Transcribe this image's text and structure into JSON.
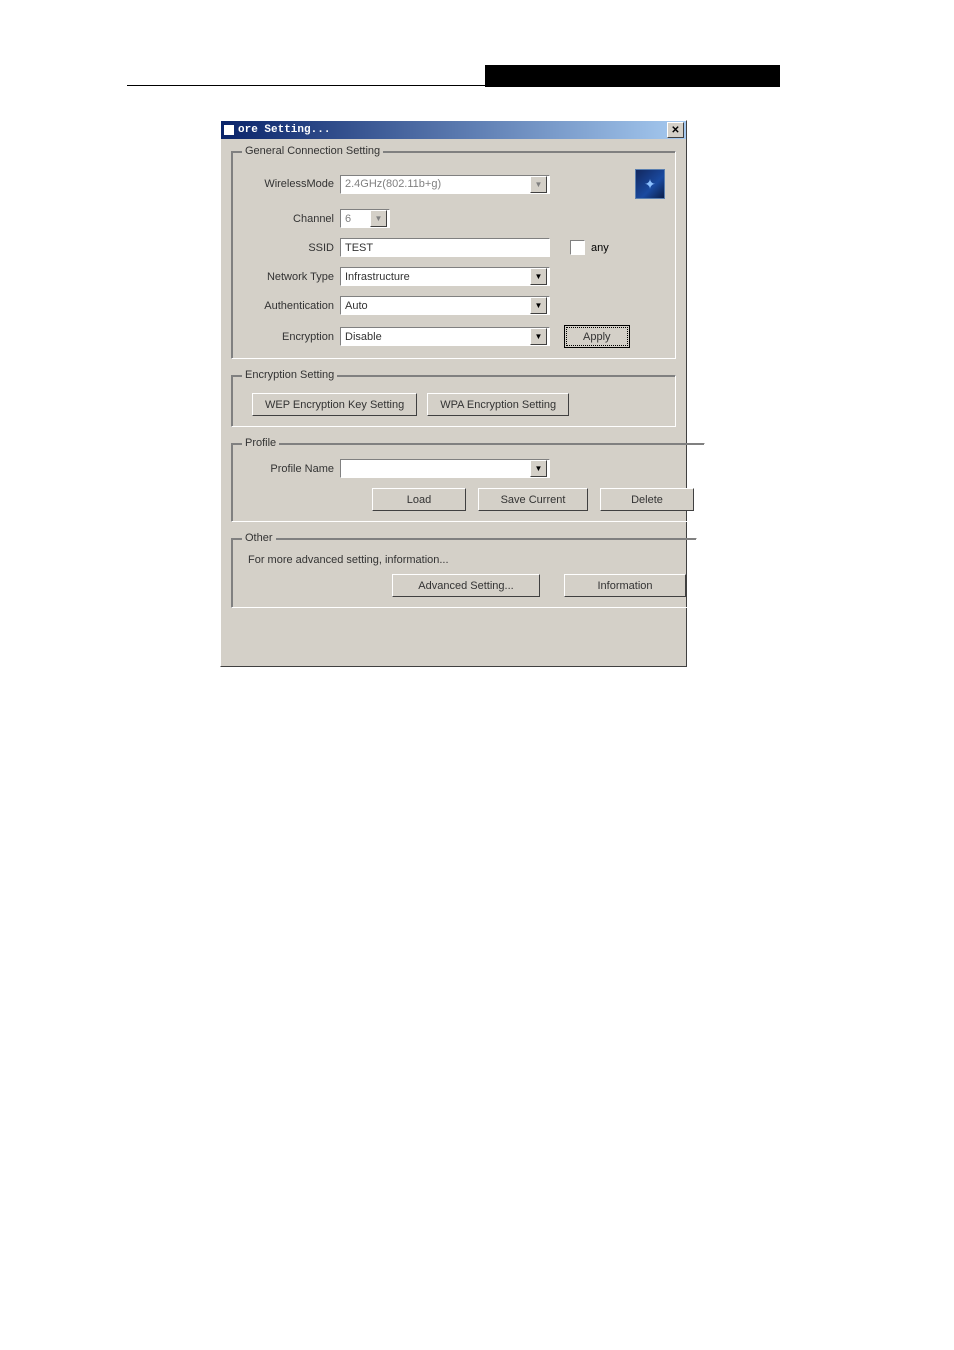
{
  "titlebar": {
    "title": "ore Setting...",
    "close": "✕"
  },
  "general": {
    "legend": "General Connection Setting",
    "wirelessLabel": "WirelessMode",
    "wirelessValue": "2.4GHz(802.11b+g)",
    "channelLabel": "Channel",
    "channelValue": "6",
    "ssidLabel": "SSID",
    "ssidValue": "TEST",
    "anyLabel": "any",
    "networkTypeLabel": "Network Type",
    "networkTypeValue": "Infrastructure",
    "authLabel": "Authentication",
    "authValue": "Auto",
    "encryptionLabel": "Encryption",
    "encryptionValue": "Disable",
    "applyBtn": "Apply"
  },
  "encryption": {
    "legend": "Encryption Setting",
    "wepBtn": "WEP Encryption Key Setting",
    "wpaBtn": "WPA Encryption Setting"
  },
  "profile": {
    "legend": "Profile",
    "nameLabel": "Profile Name",
    "nameValue": "",
    "loadBtn": "Load",
    "saveBtn": "Save Current",
    "deleteBtn": "Delete"
  },
  "other": {
    "legend": "Other",
    "text": "For more advanced setting, information...",
    "advancedBtn": "Advanced Setting...",
    "infoBtn": "Information"
  }
}
